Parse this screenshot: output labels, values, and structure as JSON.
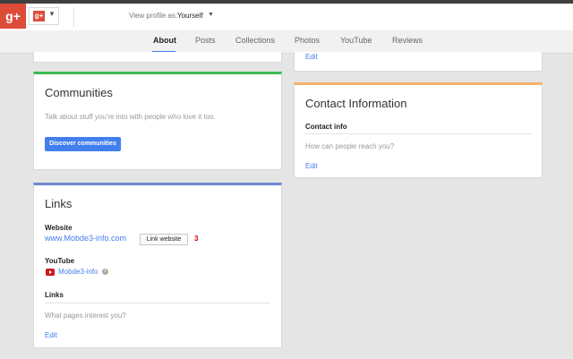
{
  "topbar": {
    "logo": "g+",
    "switcher_logo": "g+",
    "view_as_label": "View profile as:",
    "view_as_value": "Yourself"
  },
  "tabs": [
    "About",
    "Posts",
    "Collections",
    "Photos",
    "YouTube",
    "Reviews"
  ],
  "active_tab": "About",
  "top_left_card": {
    "edit": "Edit"
  },
  "communities": {
    "title": "Communities",
    "description": "Talk about stuff you're into with people who love it too.",
    "button": "Discover communities"
  },
  "links": {
    "title": "Links",
    "website_label": "Website",
    "website_value": "www.Mobde3-info.com",
    "link_website_button": "Link website",
    "badge_number": "3",
    "youtube_label": "YouTube",
    "youtube_value": "Mobde3-info",
    "links_label": "Links",
    "links_placeholder": "What pages interest you?",
    "edit": "Edit"
  },
  "contact": {
    "title": "Contact Information",
    "section_label": "Contact info",
    "placeholder": "How can people reach you?",
    "edit": "Edit"
  },
  "colors": {
    "brand_red": "#dd4b39",
    "accent_blue": "#427fed",
    "communities_bar": "#3cba54",
    "links_bar": "#6f87d0",
    "contact_bar": "#f6b26b"
  },
  "icons": [
    "google-plus-icon",
    "chevron-down-icon",
    "youtube-icon",
    "info-icon"
  ]
}
